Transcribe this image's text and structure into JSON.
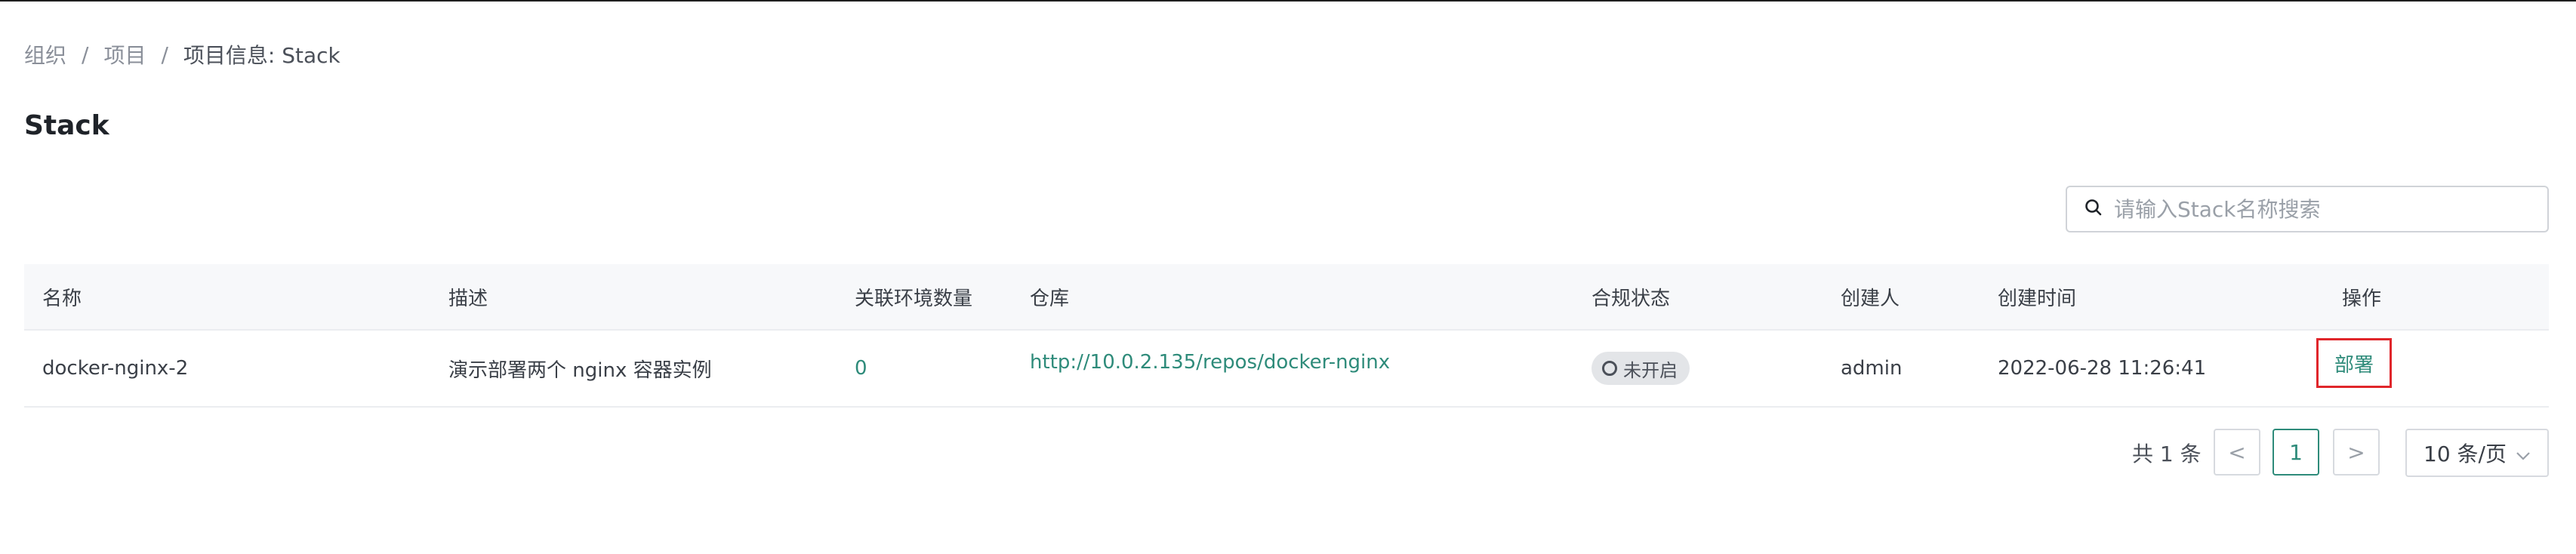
{
  "breadcrumb": {
    "items": [
      "组织",
      "项目"
    ],
    "separator": "/",
    "current": "项目信息: Stack"
  },
  "page_title": "Stack",
  "search": {
    "placeholder": "请输入Stack名称搜索",
    "value": ""
  },
  "table": {
    "headers": [
      "名称",
      "描述",
      "关联环境数量",
      "仓库",
      "合规状态",
      "创建人",
      "创建时间",
      "操作"
    ],
    "rows": [
      {
        "name": "docker-nginx-2",
        "description": "演示部署两个 nginx 容器实例",
        "env_count": "0",
        "repo": "http://10.0.2.135/repos/docker-nginx",
        "compliance": "未开启",
        "creator": "admin",
        "created_at": "2022-06-28 11:26:41",
        "action": "部署"
      }
    ]
  },
  "pagination": {
    "total_text": "共 1 条",
    "prev": "<",
    "current_page": "1",
    "next": ">",
    "page_size": "10 条/页"
  },
  "colors": {
    "accent": "#2e8b7a",
    "highlight_box": "#e0262b",
    "header_bg": "#f7f8fa"
  },
  "icons": {
    "search": "search-icon",
    "status": "circle-outline-icon",
    "dropdown": "chevron-down-icon"
  }
}
